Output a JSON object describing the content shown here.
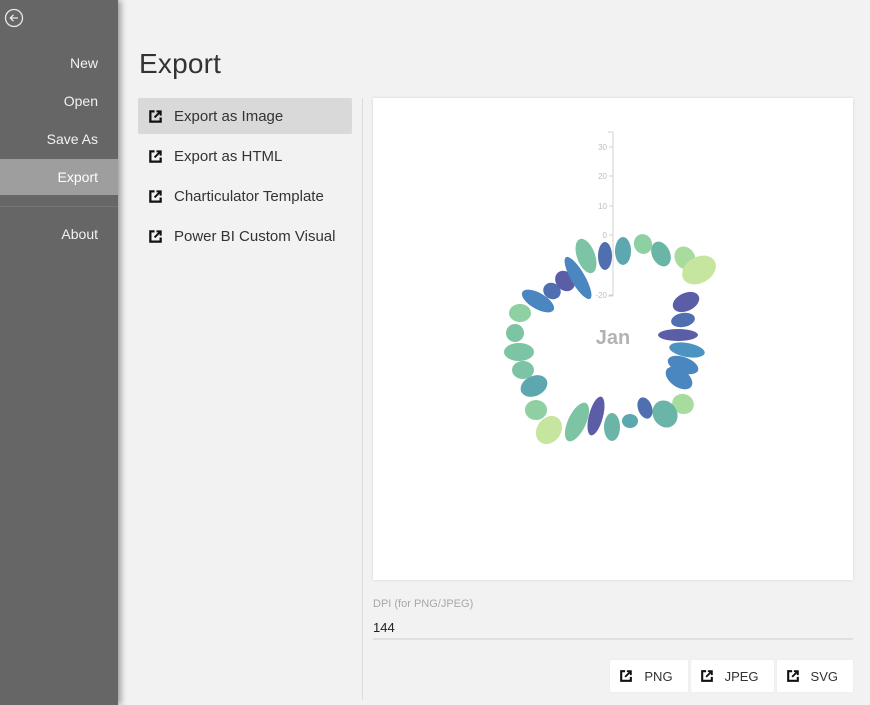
{
  "sidebar": {
    "back_icon": "arrow-left-circle-icon",
    "items": [
      {
        "label": "New"
      },
      {
        "label": "Open"
      },
      {
        "label": "Save As"
      },
      {
        "label": "Export",
        "active": true
      },
      {
        "label": "About"
      }
    ]
  },
  "page": {
    "title": "Export"
  },
  "export_options": [
    {
      "label": "Export as Image",
      "icon": "external-link-icon",
      "active": true
    },
    {
      "label": "Export as HTML",
      "icon": "external-link-icon"
    },
    {
      "label": "Charticulator Template",
      "icon": "external-link-icon"
    },
    {
      "label": "Power BI Custom Visual",
      "icon": "external-link-icon"
    }
  ],
  "preview": {
    "center_label": "Jan",
    "axis_ticks": [
      "30",
      "20",
      "10",
      "0",
      "-20"
    ],
    "palette": [
      "#5b5ea6",
      "#4f6fb0",
      "#4a86bf",
      "#4b93c0",
      "#5da7b1",
      "#6ab5a8",
      "#7cc4a3",
      "#8fd0a2",
      "#a8dc9e",
      "#c6e6a0"
    ]
  },
  "dpi": {
    "label": "DPI (for PNG/JPEG)",
    "value": "144"
  },
  "format_buttons": [
    {
      "label": "PNG",
      "icon": "external-link-icon"
    },
    {
      "label": "JPEG",
      "icon": "external-link-icon"
    },
    {
      "label": "SVG",
      "icon": "external-link-icon"
    }
  ]
}
